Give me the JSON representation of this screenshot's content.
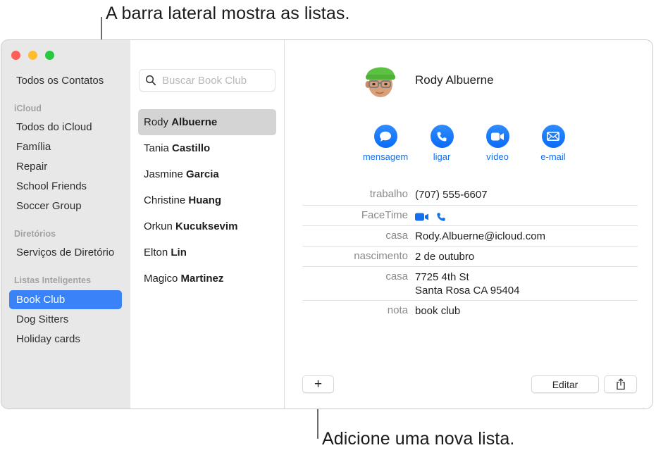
{
  "callouts": {
    "top": "A barra lateral mostra as listas.",
    "bottom": "Adicione uma nova lista."
  },
  "colors": {
    "accent": "#3a82f7",
    "action_blue": "#1470ef",
    "close": "#fe5f57",
    "minimize": "#febc2e",
    "zoom": "#28c840"
  },
  "sidebar": {
    "all_contacts": "Todos os Contatos",
    "sections": [
      {
        "header": "iCloud",
        "items": [
          "Todos do iCloud",
          "Família",
          "Repair",
          "School Friends",
          "Soccer Group"
        ]
      },
      {
        "header": "Diretórios",
        "items": [
          "Serviços de Diretório"
        ]
      },
      {
        "header": "Listas Inteligentes",
        "items": [
          "Book Club",
          "Dog Sitters",
          "Holiday cards"
        ]
      }
    ],
    "selected": "Book Club"
  },
  "contact_list": {
    "search_placeholder": "Buscar Book Club",
    "search_value": "",
    "contacts": [
      {
        "first": "Rody",
        "last": "Albuerne",
        "selected": true
      },
      {
        "first": "Tania",
        "last": "Castillo"
      },
      {
        "first": "Jasmine",
        "last": "Garcia"
      },
      {
        "first": "Christine",
        "last": "Huang"
      },
      {
        "first": "Orkun",
        "last": "Kucuksevim"
      },
      {
        "first": "Elton",
        "last": "Lin"
      },
      {
        "first": "Magico",
        "last": "Martinez"
      }
    ]
  },
  "detail": {
    "name": "Rody Albuerne",
    "actions": [
      {
        "icon": "message-icon",
        "label": "mensagem"
      },
      {
        "icon": "phone-icon",
        "label": "ligar"
      },
      {
        "icon": "video-icon",
        "label": "vídeo"
      },
      {
        "icon": "mail-icon",
        "label": "e-mail"
      }
    ],
    "fields": [
      {
        "label": "trabalho",
        "value": "(707) 555-6607"
      },
      {
        "label": "FaceTime",
        "value": "",
        "icons": [
          "video-icon",
          "phone-icon"
        ]
      },
      {
        "label": "casa",
        "value": "Rody.Albuerne@icloud.com"
      },
      {
        "label": "nascimento",
        "value": "2 de outubro"
      },
      {
        "label": "casa",
        "value_lines": [
          "7725 4th St",
          "Santa Rosa CA 95404"
        ]
      },
      {
        "label": "nota",
        "value": "book club"
      }
    ]
  },
  "toolbar": {
    "add_label": "+",
    "edit_label": "Editar",
    "share_icon": "share-icon"
  }
}
